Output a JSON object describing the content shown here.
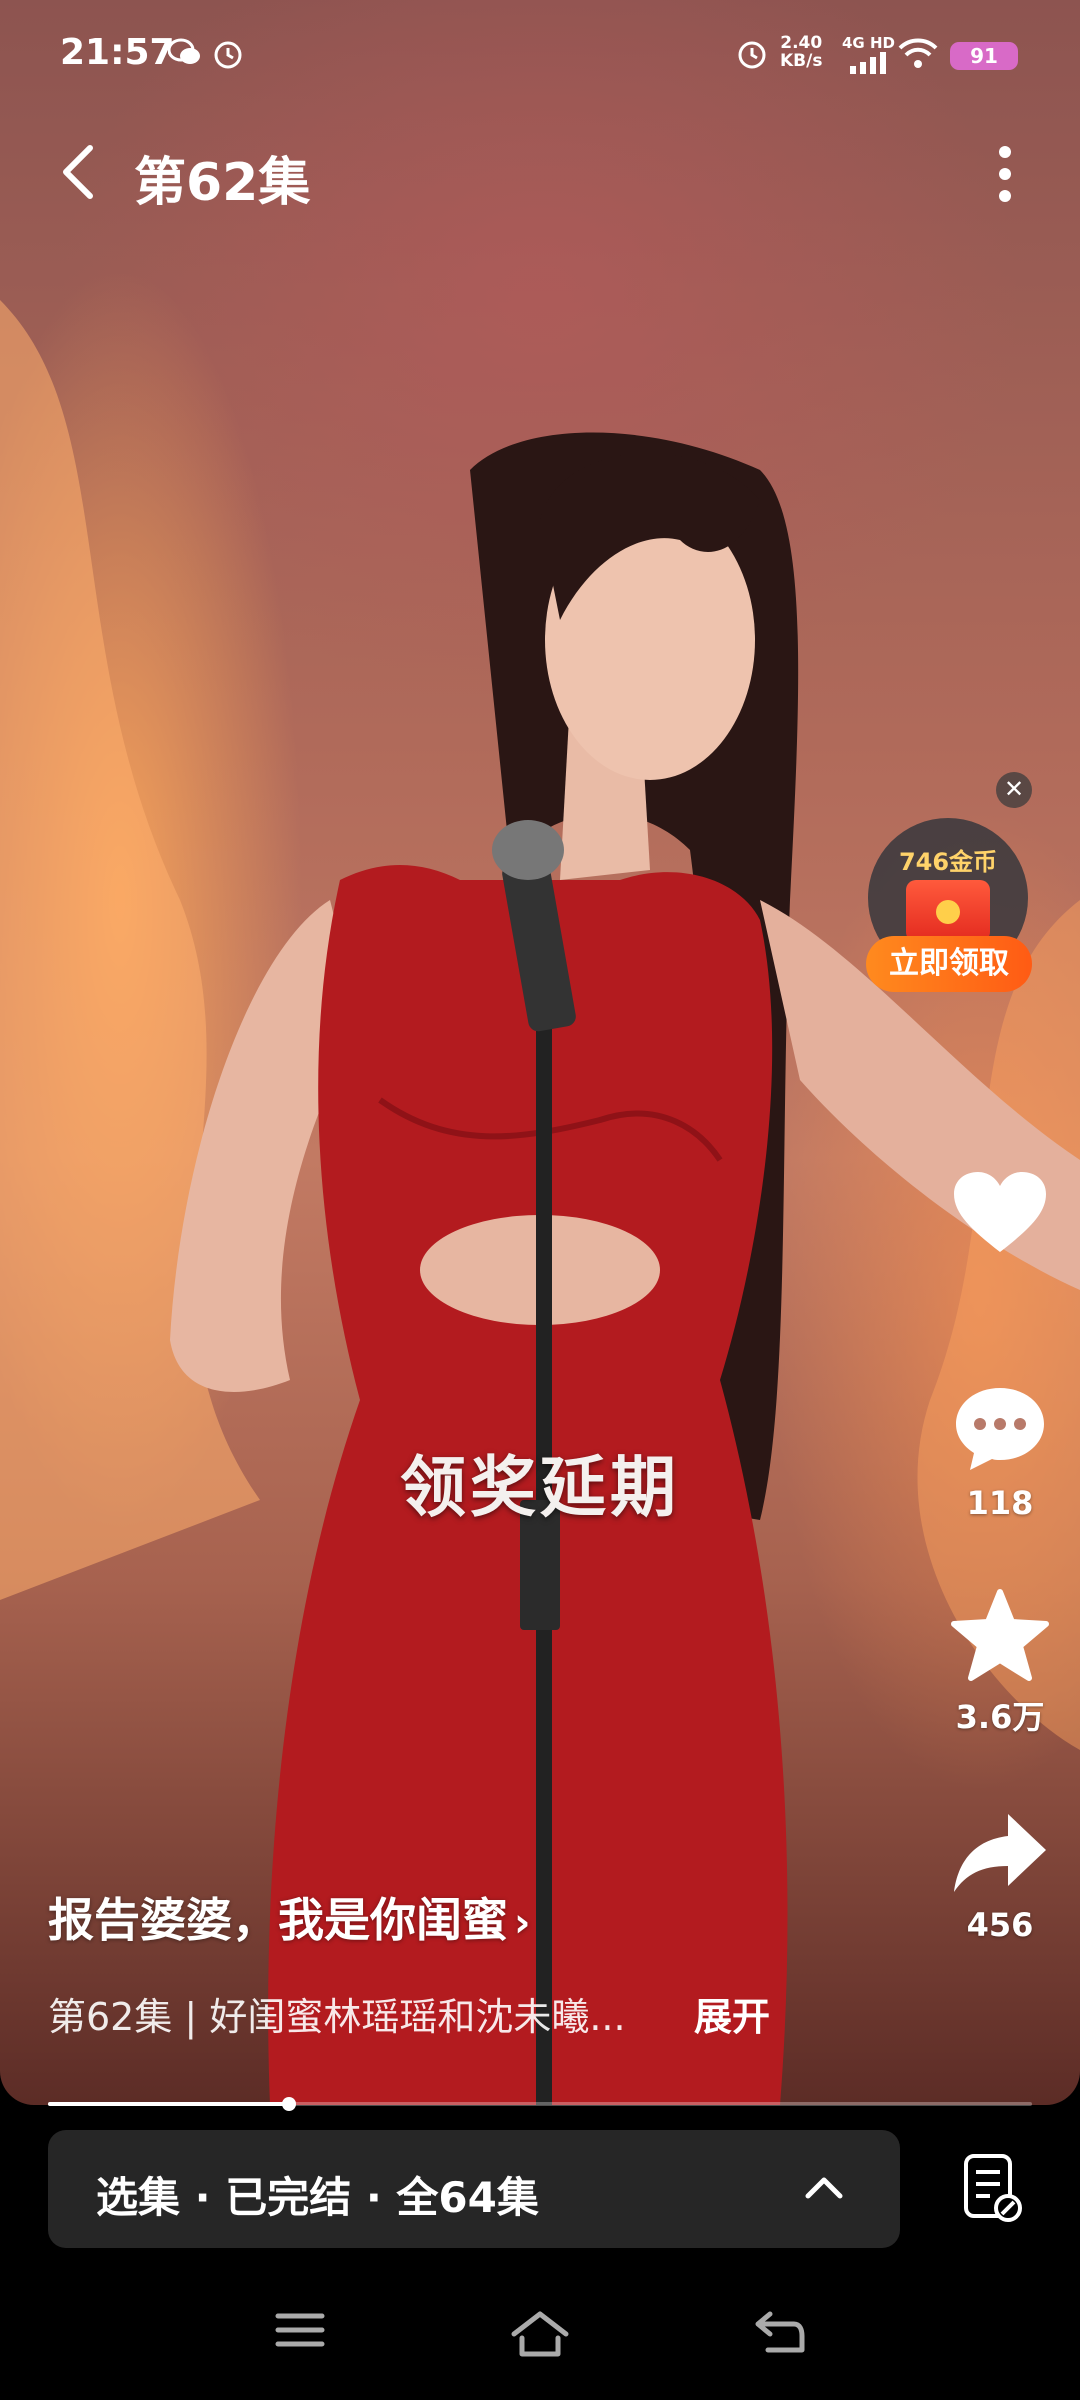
{
  "status_bar": {
    "time": "21:57",
    "net_speed_value": "2.40",
    "net_speed_unit": "KB/s",
    "network": "4G HD",
    "battery": "91"
  },
  "top_bar": {
    "episode_title": "第62集"
  },
  "video": {
    "subtitle": "领奖延期"
  },
  "reward": {
    "coins": "746金币",
    "button": "立即领取"
  },
  "actions": {
    "comment_count": "118",
    "favorite_count": "3.6万",
    "share_count": "456"
  },
  "info": {
    "drama_title": "报告婆婆，我是你闺蜜",
    "description": "第62集 | 好闺蜜林瑶瑶和沈未曦...",
    "expand": "展开"
  },
  "progress": {
    "fraction": 0.245
  },
  "episode_bar": {
    "label": "选集 · 已完结 · 全64集"
  },
  "colors": {
    "reward_orange": "#ff6a16",
    "battery_badge": "#d86ac7",
    "episode_bar_bg": "#262626"
  }
}
